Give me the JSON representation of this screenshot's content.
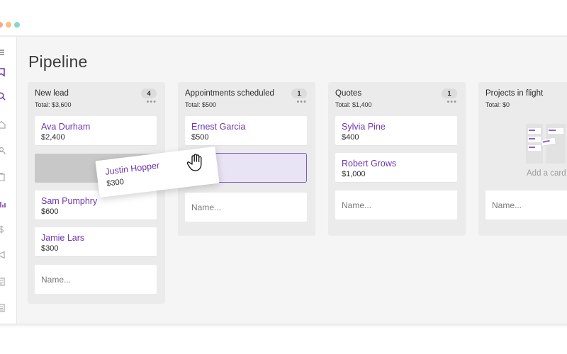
{
  "window": {
    "dots": [
      "#f4a993",
      "#f6c27d",
      "#8ad6c6"
    ]
  },
  "sidebar": {
    "icons": [
      "menu-icon",
      "bookmark-icon",
      "search-icon",
      "home-icon",
      "user-icon",
      "clipboard-icon",
      "chart-icon",
      "dollar-icon",
      "megaphone-icon",
      "document-stack-icon",
      "document-icon"
    ]
  },
  "page": {
    "title": "Pipeline"
  },
  "columns": [
    {
      "title": "New lead",
      "count": "4",
      "total": "Total: $3,600",
      "cards": [
        {
          "name": "Ava Durham",
          "amount": "$2,400"
        },
        {
          "name": "Sam Pumphry",
          "amount": "$600"
        },
        {
          "name": "Jamie Lars",
          "amount": "$300"
        }
      ],
      "input_placeholder": "Name..."
    },
    {
      "title": "Appointments scheduled",
      "count": "1",
      "total": "Total: $500",
      "cards": [
        {
          "name": "Ernest Garcia",
          "amount": "$500"
        }
      ],
      "input_placeholder": "Name..."
    },
    {
      "title": "Quotes",
      "count": "1",
      "total": "Total: $1,400",
      "cards": [
        {
          "name": "Sylvia Pine",
          "amount": "$400"
        },
        {
          "name": "Robert Grows",
          "amount": "$1,000"
        }
      ],
      "input_placeholder": "Name..."
    },
    {
      "title": "Projects in flight",
      "total": "Total: $0",
      "empty_text": "Add a card",
      "input_placeholder": "Name..."
    }
  ],
  "dragging_card": {
    "name": "Justin Hopper",
    "amount": "$300"
  },
  "colors": {
    "accent": "#6b35b0",
    "drop_border": "#7b5cc7",
    "column_bg": "#ebebeb"
  }
}
